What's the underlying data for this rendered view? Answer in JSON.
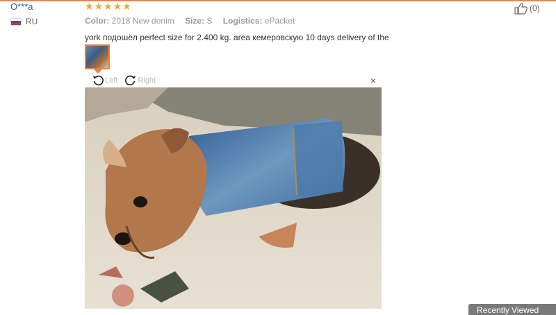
{
  "user": {
    "name": "O***a",
    "country": "RU"
  },
  "review": {
    "stars": 5,
    "color_key": "Color:",
    "color_value": "2018 New denim",
    "size_key": "Size:",
    "size_value": "S",
    "logistics_key": "Logistics:",
    "logistics_value": "ePacket",
    "text": "york подошёл perfect size for 2.400 kg. area кемеровскую 10 days delivery of the"
  },
  "viewer": {
    "left_label": "Left",
    "right_label": "Right",
    "close_symbol": "×"
  },
  "like": {
    "count": "(0)"
  },
  "recently_viewed": "Recently Viewed",
  "colors": {
    "accent": "#e6834a",
    "username": "#2a5fa8",
    "star": "#f5a623"
  },
  "icons": {
    "rotate_left": "rotate-left-icon",
    "rotate_right": "rotate-right-icon",
    "thumbs_up": "thumbs-up-icon",
    "close": "close-icon",
    "flag": "russia-flag-icon"
  }
}
